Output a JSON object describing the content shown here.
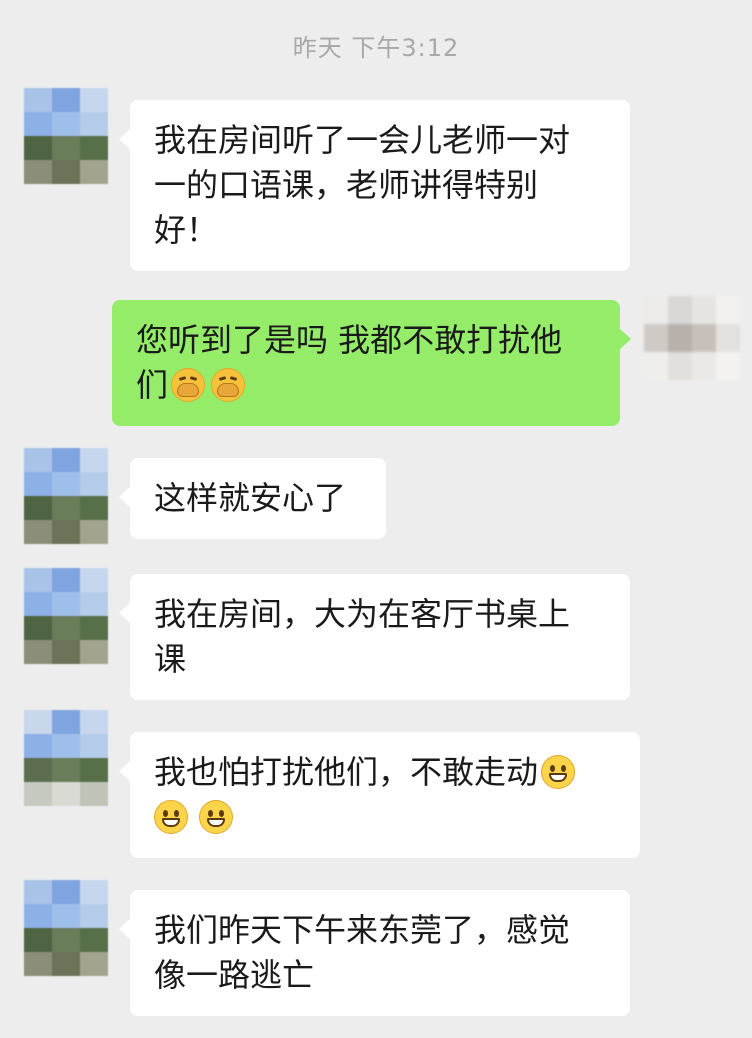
{
  "timestamp": "昨天 下午3:12",
  "colors": {
    "background": "#ededed",
    "incoming_bubble": "#ffffff",
    "outgoing_bubble": "#95ec69",
    "timestamp_text": "#a8a8a8",
    "message_text": "#1a1a1a"
  },
  "messages": [
    {
      "direction": "incoming",
      "lines": [
        "我在房间听了一会儿老师一对",
        "一的口语课，老师讲得特别",
        "好！"
      ]
    },
    {
      "direction": "outgoing",
      "lines": [
        "您听到了是吗 我都不敢打扰他",
        "们"
      ],
      "emojis": [
        "face-with-hand-over-mouth-emoji",
        "face-with-hand-over-mouth-emoji"
      ]
    },
    {
      "direction": "incoming",
      "lines": [
        "这样就安心了"
      ]
    },
    {
      "direction": "incoming",
      "lines": [
        "我在房间，大为在客厅书桌上",
        "课"
      ]
    },
    {
      "direction": "incoming",
      "lines": [
        "我也怕打扰他们，不敢走动"
      ],
      "emojis": [
        "grinning-face-emoji",
        "grinning-face-emoji",
        "grinning-face-emoji"
      ]
    },
    {
      "direction": "incoming",
      "lines": [
        "我们昨天下午来东莞了，感觉",
        "像一路逃亡"
      ]
    }
  ]
}
